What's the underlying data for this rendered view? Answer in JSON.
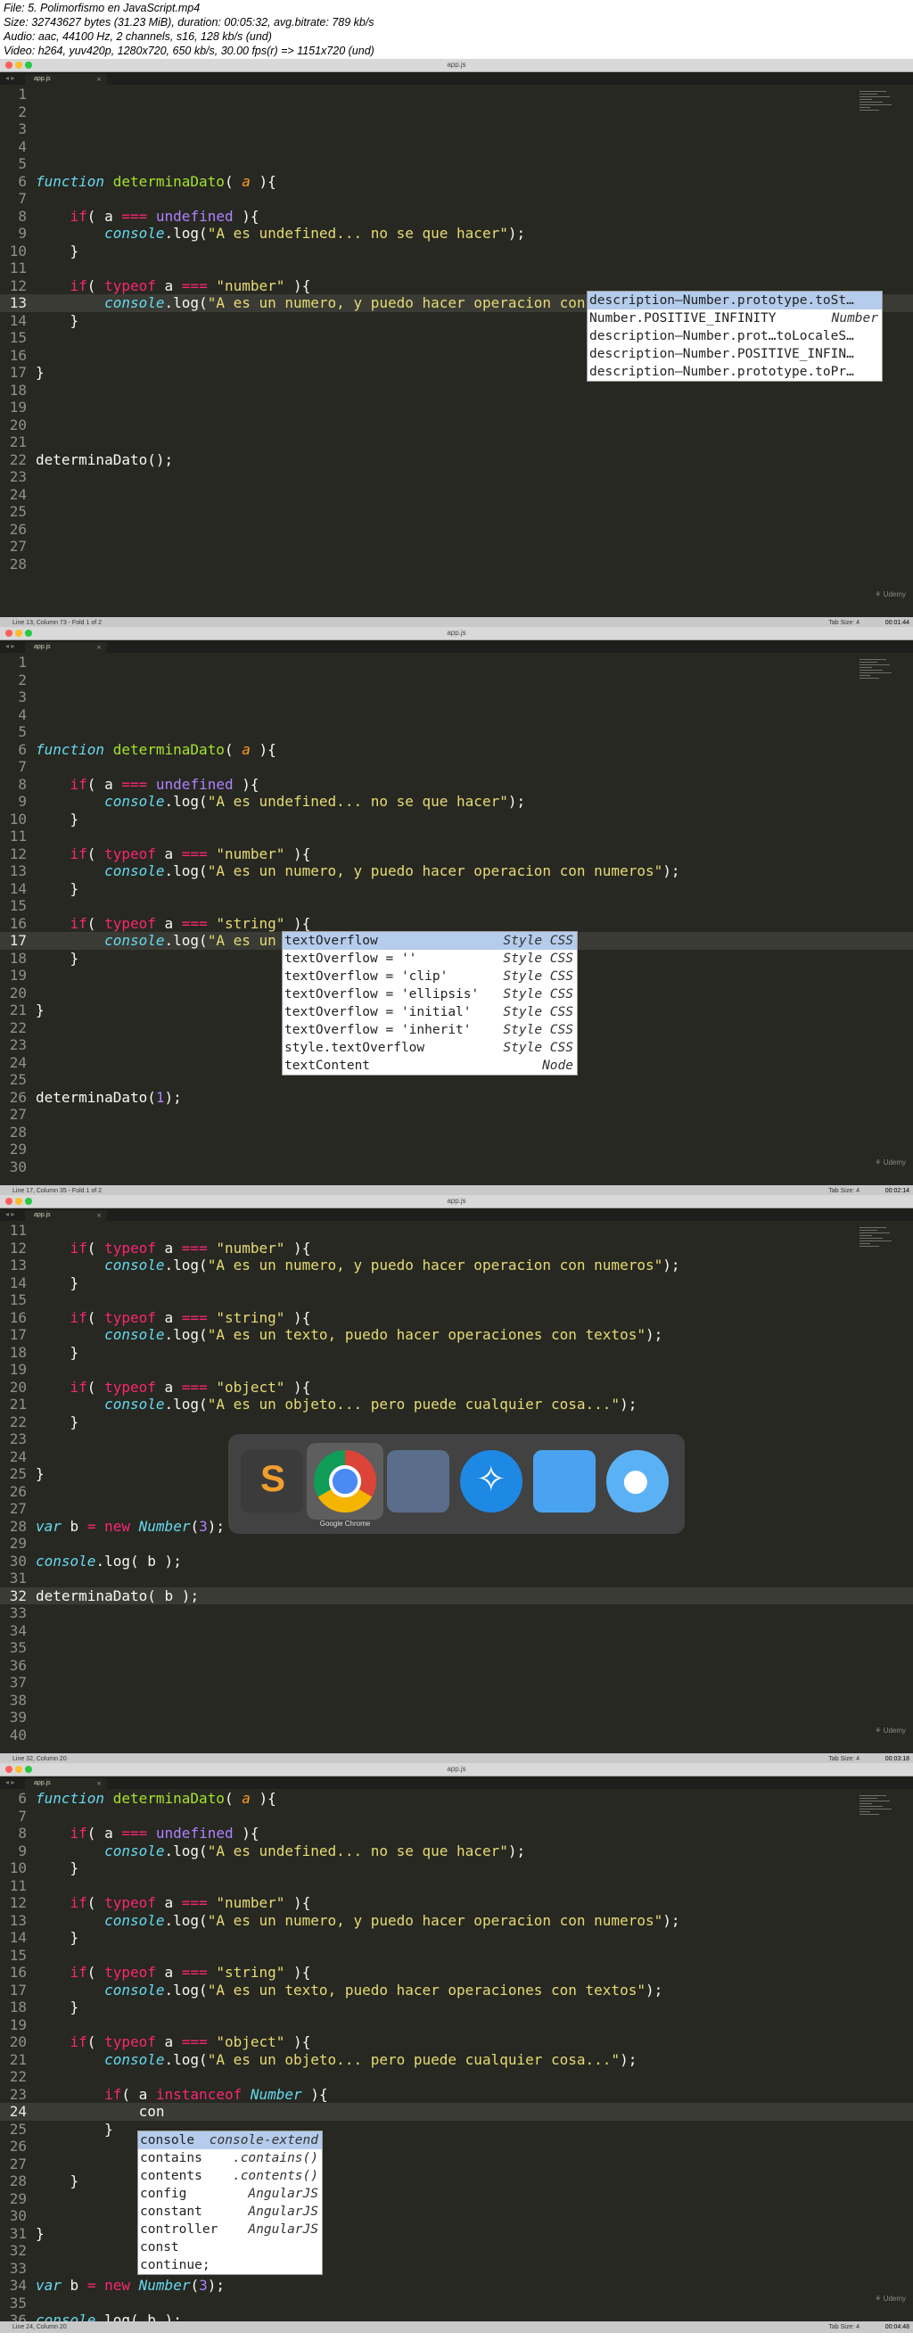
{
  "header": {
    "file_line": "File: 5. Polimorfismo en JavaScript.mp4",
    "size_line": "Size: 32743627 bytes (31.23 MiB), duration: 00:05:32, avg.bitrate: 789 kb/s",
    "audio_line": "Audio: aac, 44100 Hz, 2 channels, s16, 128 kb/s (und)",
    "video_line": "Video: h264, yuv420p, 1280x720, 650 kb/s, 30.00 fps(r) => 1151x720 (und)"
  },
  "editor": {
    "title": "app.js",
    "tab_name": "app.js",
    "watermark": "Udemy",
    "tab_size": "Tab Size: 4",
    "language": "JavaScript"
  },
  "frames": [
    {
      "status_left": "Line 13, Column 73 - Fold 1 of 2",
      "timestamp": "00:01:44",
      "first_line": 1,
      "current_line": 13,
      "lines": [
        "",
        "",
        "",
        "",
        "",
        "function determinaDato( a ){",
        "",
        "    if( a === undefined ){",
        "        console.log(\"A es undefined... no se que hacer\");",
        "    }",
        "",
        "    if( typeof a === \"number\" ){",
        "        console.log(\"A es un numero, y puedo hacer operacion con numeros\");",
        "    }",
        "",
        "",
        "}",
        "",
        "",
        "",
        "",
        "determinaDato();",
        "",
        "",
        "",
        "",
        "",
        ""
      ],
      "autocomplete": [
        {
          "label": "description—Number.prototype.toSt…",
          "hint": ""
        },
        {
          "label": "Number.POSITIVE_INFINITY",
          "hint": "Number"
        },
        {
          "label": "description—Number.prot…toLocaleS…",
          "hint": ""
        },
        {
          "label": "description—Number.POSITIVE_INFIN…",
          "hint": ""
        },
        {
          "label": "description—Number.prototype.toPr…",
          "hint": ""
        }
      ]
    },
    {
      "status_left": "Line 17, Column 35 - Fold 1 of 2",
      "timestamp": "00:02:14",
      "first_line": 1,
      "current_line": 17,
      "lines": [
        "",
        "",
        "",
        "",
        "",
        "function determinaDato( a ){",
        "",
        "    if( a === undefined ){",
        "        console.log(\"A es undefined... no se que hacer\");",
        "    }",
        "",
        "    if( typeof a === \"number\" ){",
        "        console.log(\"A es un numero, y puedo hacer operacion con numeros\");",
        "    }",
        "",
        "    if( typeof a === \"string\" ){",
        "        console.log(\"A es un texto\");",
        "    }",
        "",
        "",
        "}",
        "",
        "",
        "",
        "",
        "determinaDato(1);",
        "",
        "",
        "",
        ""
      ],
      "autocomplete": [
        {
          "label": "textOverflow",
          "hint": "Style CSS"
        },
        {
          "label": "textOverflow = ''",
          "hint": "Style CSS"
        },
        {
          "label": "textOverflow = 'clip'",
          "hint": "Style CSS"
        },
        {
          "label": "textOverflow = 'ellipsis'",
          "hint": "Style CSS"
        },
        {
          "label": "textOverflow = 'initial'",
          "hint": "Style CSS"
        },
        {
          "label": "textOverflow = 'inherit'",
          "hint": "Style CSS"
        },
        {
          "label": "style.textOverflow",
          "hint": "Style CSS"
        },
        {
          "label": "textContent",
          "hint": "Node"
        }
      ]
    },
    {
      "status_left": "Line 32, Column 20",
      "timestamp": "00:03:18",
      "first_line": 11,
      "current_line": 32,
      "lines": [
        "",
        "    if( typeof a === \"number\" ){",
        "        console.log(\"A es un numero, y puedo hacer operacion con numeros\");",
        "    }",
        "",
        "    if( typeof a === \"string\" ){",
        "        console.log(\"A es un texto, puedo hacer operaciones con textos\");",
        "    }",
        "",
        "    if( typeof a === \"object\" ){",
        "        console.log(\"A es un objeto... pero puede cualquier cosa...\");",
        "    }",
        "",
        "",
        "}",
        "",
        "",
        "var b = new Number(3);",
        "",
        "console.log( b );",
        "",
        "determinaDato( b );",
        "",
        "",
        "",
        "",
        "",
        "",
        "",
        ""
      ],
      "dock_label": "Google Chrome"
    },
    {
      "status_left": "Line 24, Column 20",
      "timestamp": "00:04:48",
      "first_line": 6,
      "current_line": 24,
      "lines": [
        "function determinaDato( a ){",
        "",
        "    if( a === undefined ){",
        "        console.log(\"A es undefined... no se que hacer\");",
        "    }",
        "",
        "    if( typeof a === \"number\" ){",
        "        console.log(\"A es un numero, y puedo hacer operacion con numeros\");",
        "    }",
        "",
        "    if( typeof a === \"string\" ){",
        "        console.log(\"A es un texto, puedo hacer operaciones con textos\");",
        "    }",
        "",
        "    if( typeof a === \"object\" ){",
        "        console.log(\"A es un objeto... pero puede cualquier cosa...\");",
        "",
        "        if( a instanceof Number ){",
        "            con",
        "        }",
        "",
        "",
        "    }",
        "",
        "",
        "}",
        "",
        "",
        "var b = new Number(3);",
        "",
        "console.log( b );"
      ],
      "autocomplete": [
        {
          "label": "console",
          "hint": "console-extend"
        },
        {
          "label": "contains",
          "hint": ".contains()"
        },
        {
          "label": "contents",
          "hint": ".contents()"
        },
        {
          "label": "config",
          "hint": "AngularJS"
        },
        {
          "label": "constant",
          "hint": "AngularJS"
        },
        {
          "label": "controller",
          "hint": "AngularJS"
        },
        {
          "label": "const",
          "hint": ""
        },
        {
          "label": "continue;",
          "hint": ""
        }
      ]
    }
  ]
}
